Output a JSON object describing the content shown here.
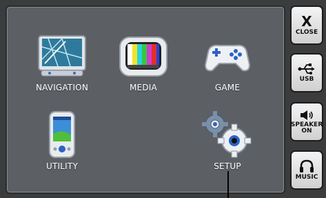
{
  "menu": {
    "navigation": "NAVIGATION",
    "media": "MEDIA",
    "game": "GAME",
    "utility": "UTILITY",
    "setup": "SETUP"
  },
  "sidebar": {
    "close_glyph": "X",
    "close": "CLOSE",
    "usb": "USB",
    "speaker_line1": "SPEAKER",
    "speaker_line2": "ON",
    "music": "MUSIC"
  },
  "icons": {
    "navigation": "map-screen-icon",
    "media": "tv-color-bars-icon",
    "game": "gamepad-icon",
    "utility": "pda-icon",
    "setup": "gears-icon",
    "usb": "usb-icon",
    "speaker": "speaker-icon",
    "music": "headphones-icon"
  },
  "colors": {
    "panel": "#5c6064",
    "background": "#3a3c3d",
    "button": "#e6e6e6",
    "text": "#ffffff"
  }
}
